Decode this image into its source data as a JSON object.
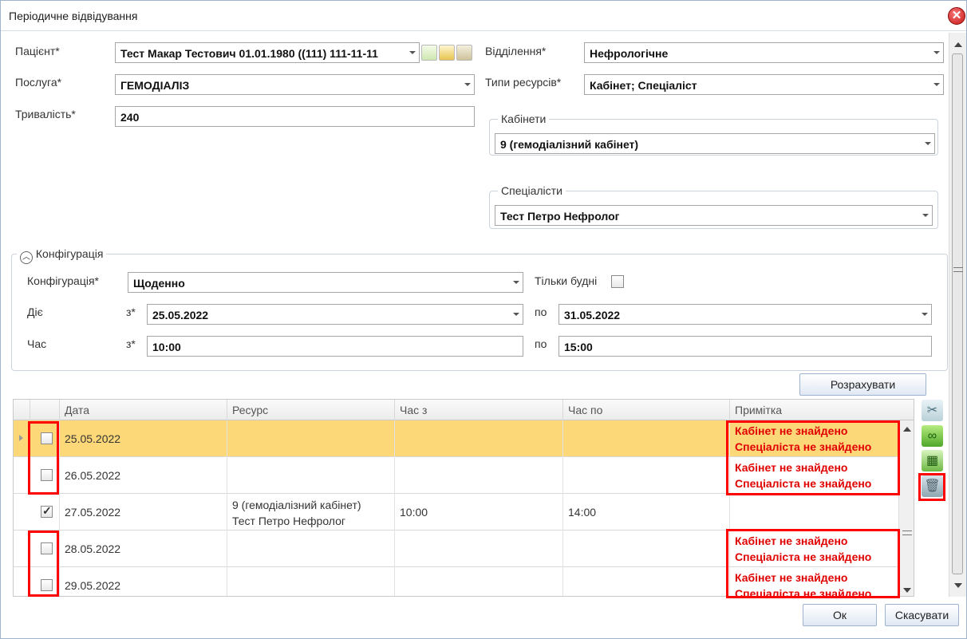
{
  "window": {
    "title": "Періодичне відвідування",
    "close_glyph": "✕"
  },
  "form": {
    "patient": {
      "label": "Пацієнт*",
      "value": "Тест Макар Тестович 01.01.1980 ((111) 111-11-11"
    },
    "service": {
      "label": "Послуга*",
      "value": "ГЕМОДІАЛІЗ"
    },
    "duration": {
      "label": "Тривалість*",
      "value": "240"
    },
    "department": {
      "label": "Відділення*",
      "value": "Нефрологічне"
    },
    "resource_types": {
      "label": "Типи ресурсів*",
      "value": "Кабінет; Спеціаліст"
    },
    "cabinets": {
      "legend": "Кабінети",
      "value": "9 (гемодіалізний кабінет)"
    },
    "specialists": {
      "legend": "Спеціалісти",
      "value": "Тест Петро Нефролог"
    }
  },
  "config": {
    "legend": "Конфігурація",
    "label": "Конфігурація*",
    "value": "Щоденно",
    "weekdays_only": {
      "label": "Тільки будні",
      "checked": false
    },
    "active": {
      "label": "Діє",
      "from_label": "з*",
      "from": "25.05.2022",
      "to_label": "по",
      "to": "31.05.2022"
    },
    "time": {
      "label": "Час",
      "from_label": "з*",
      "from": "10:00",
      "to_label": "по",
      "to": "15:00"
    }
  },
  "calc_button": "Розрахувати",
  "grid": {
    "headers": [
      "Дата",
      "Ресурс",
      "Час з",
      "Час по",
      "Примітка"
    ],
    "rows": [
      {
        "checked": false,
        "date": "25.05.2022",
        "res1": "",
        "res2": "",
        "from": "",
        "to": "",
        "note1": "Кабінет не знайдено",
        "note2": "Спеціаліста не знайдено",
        "selected": true
      },
      {
        "checked": false,
        "date": "26.05.2022",
        "res1": "",
        "res2": "",
        "from": "",
        "to": "",
        "note1": "Кабінет не знайдено",
        "note2": "Спеціаліста не знайдено",
        "selected": false
      },
      {
        "checked": true,
        "date": "27.05.2022",
        "res1": "9 (гемодіалізний кабінет)",
        "res2": "Тест Петро Нефролог",
        "from": "10:00",
        "to": "14:00",
        "note1": "",
        "note2": "",
        "selected": false
      },
      {
        "checked": false,
        "date": "28.05.2022",
        "res1": "",
        "res2": "",
        "from": "",
        "to": "",
        "note1": "Кабінет не знайдено",
        "note2": "Спеціаліста не знайдено",
        "selected": false
      },
      {
        "checked": false,
        "date": "29.05.2022",
        "res1": "",
        "res2": "",
        "from": "",
        "to": "",
        "note1": "Кабінет не знайдено",
        "note2": "Спеціаліста не знайдено",
        "selected": false
      }
    ]
  },
  "buttons": {
    "ok": "Ок",
    "cancel": "Скасувати"
  },
  "colors": {
    "highlight": "#ff0000",
    "selected_row": "#fdd878",
    "note_text": "#e00000"
  }
}
